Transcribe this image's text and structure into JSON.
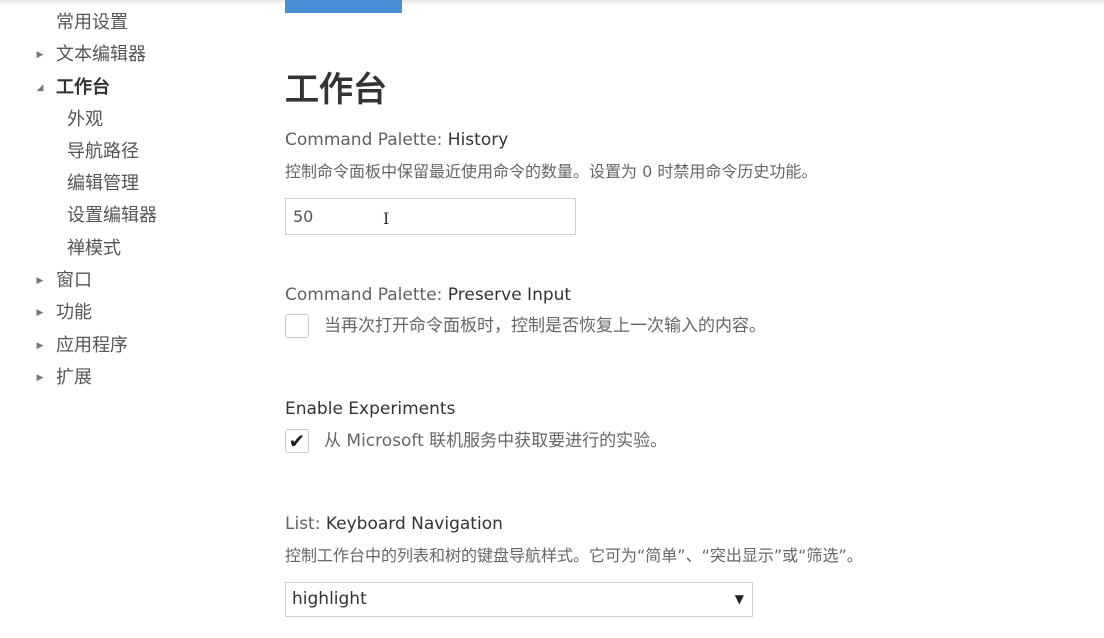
{
  "toc": {
    "items": [
      {
        "label": "常用设置",
        "twisty": ""
      },
      {
        "label": "文本编辑器",
        "twisty": "▶"
      },
      {
        "label": "工作台",
        "twisty": "◢"
      },
      {
        "label": "外观",
        "twisty": ""
      },
      {
        "label": "导航路径",
        "twisty": ""
      },
      {
        "label": "编辑管理",
        "twisty": ""
      },
      {
        "label": "设置编辑器",
        "twisty": ""
      },
      {
        "label": "禅模式",
        "twisty": ""
      },
      {
        "label": "窗口",
        "twisty": "▶"
      },
      {
        "label": "功能",
        "twisty": "▶"
      },
      {
        "label": "应用程序",
        "twisty": "▶"
      },
      {
        "label": "扩展",
        "twisty": "▶"
      }
    ]
  },
  "main": {
    "section_title": "工作台",
    "settings": {
      "history": {
        "category": "Command Palette: ",
        "key": "History",
        "description": "控制命令面板中保留最近使用命令的数量。设置为 0 时禁用命令历史功能。",
        "value": "50",
        "cursor_glyph": "I"
      },
      "preserve_input": {
        "category": "Command Palette: ",
        "key": "Preserve Input",
        "description": "当再次打开命令面板时，控制是否恢复上一次输入的内容。",
        "checked_glyph": ""
      },
      "experiments": {
        "category": "",
        "key": "Enable Experiments",
        "description": "从 Microsoft 联机服务中获取要进行的实验。",
        "checked_glyph": "✔"
      },
      "keyboard_navigation": {
        "category": "List: ",
        "key": "Keyboard Navigation",
        "description": "控制工作台中的列表和树的键盘导航样式。它可为“简单”、“突出显示”或“筛选”。",
        "selected": "highlight",
        "arrow": "▼"
      }
    }
  }
}
